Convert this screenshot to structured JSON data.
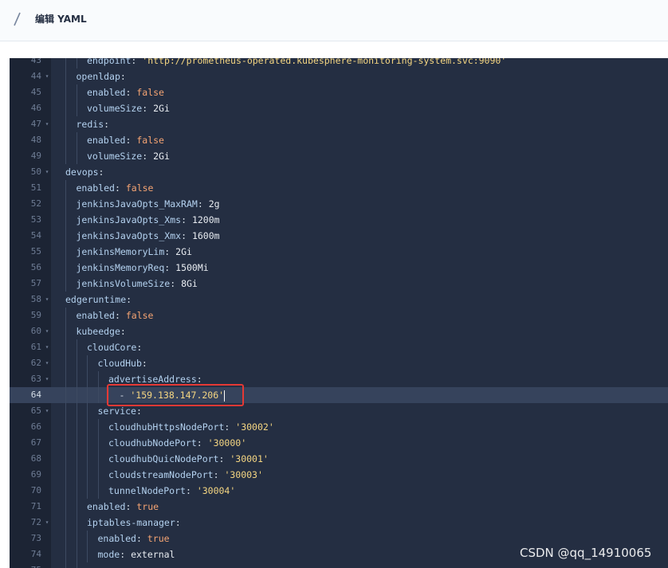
{
  "header": {
    "title": "编辑 YAML"
  },
  "editor": {
    "active_line": "64",
    "lines": [
      {
        "n": "43",
        "indent": 2,
        "fold": false,
        "key": "endpoint",
        "value": "'http://prometheus-operated.kubesphere-monitoring-system.svc:9090'",
        "vtype": "s"
      },
      {
        "n": "44",
        "indent": 1,
        "fold": true,
        "key": "openldap",
        "value": "",
        "vtype": ""
      },
      {
        "n": "45",
        "indent": 2,
        "fold": false,
        "key": "enabled",
        "value": "false",
        "vtype": "b"
      },
      {
        "n": "46",
        "indent": 2,
        "fold": false,
        "key": "volumeSize",
        "value": "2Gi",
        "vtype": "n"
      },
      {
        "n": "47",
        "indent": 1,
        "fold": true,
        "key": "redis",
        "value": "",
        "vtype": ""
      },
      {
        "n": "48",
        "indent": 2,
        "fold": false,
        "key": "enabled",
        "value": "false",
        "vtype": "b"
      },
      {
        "n": "49",
        "indent": 2,
        "fold": false,
        "key": "volumeSize",
        "value": "2Gi",
        "vtype": "n"
      },
      {
        "n": "50",
        "indent": 0,
        "fold": true,
        "key": "devops",
        "value": "",
        "vtype": ""
      },
      {
        "n": "51",
        "indent": 1,
        "fold": false,
        "key": "enabled",
        "value": "false",
        "vtype": "b"
      },
      {
        "n": "52",
        "indent": 1,
        "fold": false,
        "key": "jenkinsJavaOpts_MaxRAM",
        "value": "2g",
        "vtype": "n"
      },
      {
        "n": "53",
        "indent": 1,
        "fold": false,
        "key": "jenkinsJavaOpts_Xms",
        "value": "1200m",
        "vtype": "n"
      },
      {
        "n": "54",
        "indent": 1,
        "fold": false,
        "key": "jenkinsJavaOpts_Xmx",
        "value": "1600m",
        "vtype": "n"
      },
      {
        "n": "55",
        "indent": 1,
        "fold": false,
        "key": "jenkinsMemoryLim",
        "value": "2Gi",
        "vtype": "n"
      },
      {
        "n": "56",
        "indent": 1,
        "fold": false,
        "key": "jenkinsMemoryReq",
        "value": "1500Mi",
        "vtype": "n"
      },
      {
        "n": "57",
        "indent": 1,
        "fold": false,
        "key": "jenkinsVolumeSize",
        "value": "8Gi",
        "vtype": "n"
      },
      {
        "n": "58",
        "indent": 0,
        "fold": true,
        "key": "edgeruntime",
        "value": "",
        "vtype": ""
      },
      {
        "n": "59",
        "indent": 1,
        "fold": false,
        "key": "enabled",
        "value": "false",
        "vtype": "b"
      },
      {
        "n": "60",
        "indent": 1,
        "fold": true,
        "key": "kubeedge",
        "value": "",
        "vtype": ""
      },
      {
        "n": "61",
        "indent": 2,
        "fold": true,
        "key": "cloudCore",
        "value": "",
        "vtype": ""
      },
      {
        "n": "62",
        "indent": 3,
        "fold": true,
        "key": "cloudHub",
        "value": "",
        "vtype": ""
      },
      {
        "n": "63",
        "indent": 4,
        "fold": true,
        "key": "advertiseAddress",
        "value": "",
        "vtype": ""
      },
      {
        "n": "64",
        "indent": 5,
        "fold": false,
        "key": "",
        "value": "'159.138.147.206'",
        "vtype": "s",
        "dash": "- "
      },
      {
        "n": "65",
        "indent": 3,
        "fold": true,
        "key": "service",
        "value": "",
        "vtype": ""
      },
      {
        "n": "66",
        "indent": 4,
        "fold": false,
        "key": "cloudhubHttpsNodePort",
        "value": "'30002'",
        "vtype": "s"
      },
      {
        "n": "67",
        "indent": 4,
        "fold": false,
        "key": "cloudhubNodePort",
        "value": "'30000'",
        "vtype": "s"
      },
      {
        "n": "68",
        "indent": 4,
        "fold": false,
        "key": "cloudhubQuicNodePort",
        "value": "'30001'",
        "vtype": "s"
      },
      {
        "n": "69",
        "indent": 4,
        "fold": false,
        "key": "cloudstreamNodePort",
        "value": "'30003'",
        "vtype": "s"
      },
      {
        "n": "70",
        "indent": 4,
        "fold": false,
        "key": "tunnelNodePort",
        "value": "'30004'",
        "vtype": "s"
      },
      {
        "n": "71",
        "indent": 2,
        "fold": false,
        "key": "enabled",
        "value": "true",
        "vtype": "b"
      },
      {
        "n": "72",
        "indent": 2,
        "fold": true,
        "key": "iptables-manager",
        "value": "",
        "vtype": ""
      },
      {
        "n": "73",
        "indent": 3,
        "fold": false,
        "key": "enabled",
        "value": "true",
        "vtype": "b"
      },
      {
        "n": "74",
        "indent": 3,
        "fold": false,
        "key": "mode",
        "value": "external",
        "vtype": "n"
      },
      {
        "n": "75",
        "indent": 2,
        "fold": false,
        "key": "",
        "value": "",
        "vtype": ""
      }
    ]
  },
  "watermark": "CSDN @qq_14910065",
  "colors": {
    "key": "#b4d2f0",
    "string": "#f5d682",
    "boolean": "#f5a473",
    "highlight": "#e53935"
  }
}
